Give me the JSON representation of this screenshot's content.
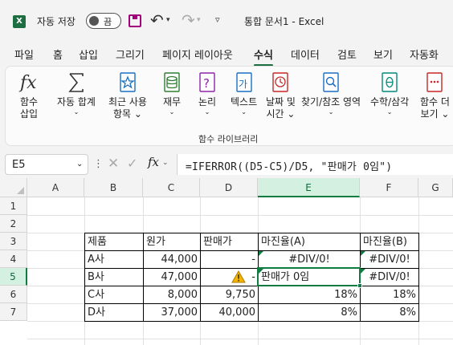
{
  "titlebar": {
    "app_logo": "X",
    "autosave_label": "자동 저장",
    "autosave_state": "끔",
    "doc_title": "통합 문서1 - Excel",
    "icons": [
      "excel-logo-icon",
      "save-icon",
      "undo-icon",
      "redo-icon",
      "customize-qat-icon"
    ]
  },
  "menu": {
    "tabs": [
      "파일",
      "홈",
      "삽입",
      "그리기",
      "페이지 레이아웃",
      "수식",
      "데이터",
      "검토",
      "보기",
      "자동화"
    ],
    "active": "수식"
  },
  "ribbon": {
    "buttons": [
      {
        "line1": "함수",
        "line2": "삽입",
        "icon": "fx-icon"
      },
      {
        "line1": "자동 합계",
        "line2": "⌄",
        "icon": "sigma-icon"
      },
      {
        "line1": "최근 사용",
        "line2": "항목 ⌄",
        "icon": "star-book-icon"
      },
      {
        "line1": "재무",
        "line2": "⌄",
        "icon": "finance-book-icon"
      },
      {
        "line1": "논리",
        "line2": "⌄",
        "icon": "logical-book-icon"
      },
      {
        "line1": "텍스트",
        "line2": "⌄",
        "icon": "text-book-icon"
      },
      {
        "line1": "날짜 및",
        "line2": "시간 ⌄",
        "icon": "clock-book-icon"
      },
      {
        "line1": "찾기/참조 영역",
        "line2": "⌄",
        "icon": "lookup-book-icon"
      },
      {
        "line1": "수학/삼각",
        "line2": "⌄",
        "icon": "math-book-icon"
      },
      {
        "line1": "함수 더",
        "line2": "보기 ⌄",
        "icon": "more-functions-icon"
      }
    ],
    "group_label": "함수 라이브러리"
  },
  "formula_bar": {
    "name_box": "E5",
    "fx": "fx",
    "formula": "=IFERROR((D5-C5)/D5, \"판매가 0임\")"
  },
  "sheet": {
    "columns": [
      "A",
      "B",
      "C",
      "D",
      "E",
      "F",
      "G"
    ],
    "rows": [
      "1",
      "2",
      "3",
      "4",
      "5",
      "6",
      "7"
    ],
    "selected_cell": "E5",
    "header_row": {
      "B": "제품",
      "C": "원가",
      "D": "판매가",
      "E": "마진율(A)",
      "F": "마진율(B)"
    },
    "data_rows": [
      {
        "B": "A사",
        "C": "44,000",
        "D": "-",
        "E": "#DIV/0!",
        "F": "#DIV/0!"
      },
      {
        "B": "B사",
        "C": "47,000",
        "D": "-",
        "E": "판매가 0임",
        "F": "#DIV/0!"
      },
      {
        "B": "C사",
        "C": "8,000",
        "D": "9,750",
        "E": "18%",
        "F": "18%"
      },
      {
        "B": "D사",
        "C": "37,000",
        "D": "40,000",
        "E": "8%",
        "F": "8%"
      }
    ],
    "error_indicator_cells": [
      "E4",
      "F4",
      "E5",
      "F5"
    ],
    "warning_icon": "warning-triangle-icon",
    "accent_color": "#107c41"
  }
}
